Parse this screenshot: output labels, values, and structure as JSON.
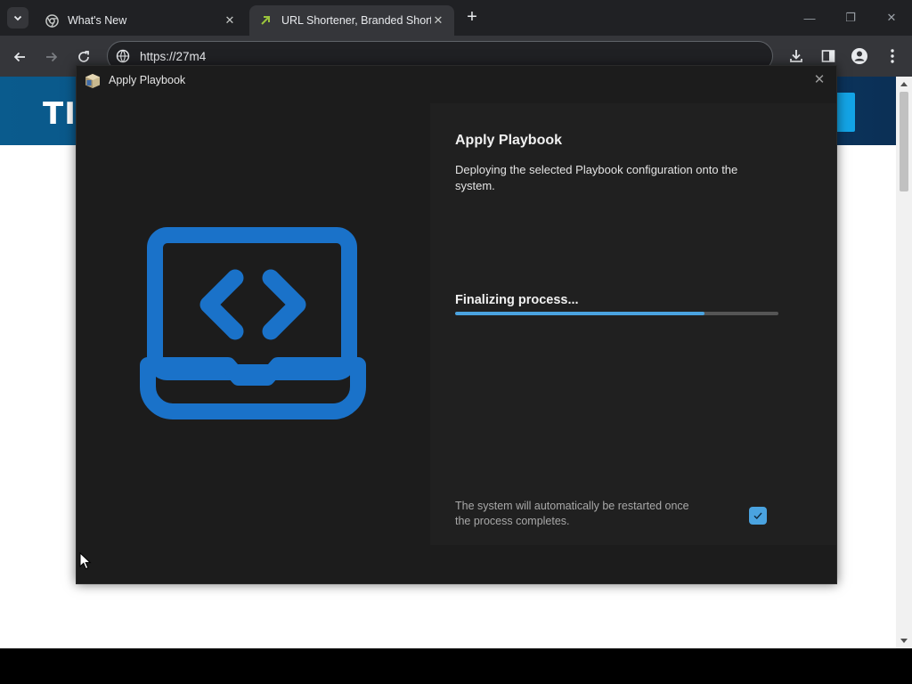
{
  "browser": {
    "tabs": [
      {
        "title": "What's New",
        "favicon": "chrome-icon",
        "active": false
      },
      {
        "title": "URL Shortener, Branded Short L",
        "favicon": "shortener-favicon",
        "active": true
      }
    ],
    "new_tab_symbol": "+",
    "tab_close_symbol": "✕",
    "window_controls": {
      "minimize": "—",
      "restore": "❐",
      "close": "✕"
    },
    "url": "https://27m4"
  },
  "page": {
    "logo_text": "TI",
    "banner_colors": [
      "#0a5b8d",
      "#0b2f55"
    ]
  },
  "dialog": {
    "title": "Apply Playbook",
    "close_symbol": "✕",
    "hero_icon": "laptop-code-icon",
    "accent_color": "#1a72c9",
    "heading": "Apply Playbook",
    "description": "Deploying the selected Playbook configuration onto the system.",
    "status_text": "Finalizing process...",
    "progress": 0.77,
    "restart_note": "The system will automatically be restarted once the process completes.",
    "restart_checkbox_checked": true
  }
}
